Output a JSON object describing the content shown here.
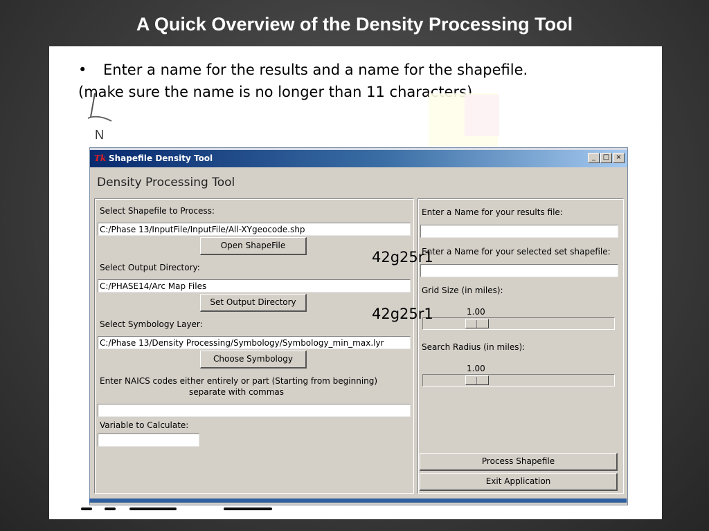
{
  "slide": {
    "title": "A Quick Overview of the Density Processing Tool",
    "bullet_marker": "•",
    "bullet_text": "Enter a name for the results and a name for the shapefile.",
    "note_text": "(make sure the name is no longer than 11 characters)",
    "north_label": "N"
  },
  "window": {
    "icon_text": "Tk",
    "title": "Shapefile Density Tool",
    "controls": {
      "minimize": "_",
      "maximize": "□",
      "close": "×"
    },
    "heading": "Density Processing Tool"
  },
  "left_panel": {
    "shapefile_label": "Select Shapefile to Process:",
    "shapefile_value": "C:/Phase 13/InputFile/InputFile/All-XYgeocode.shp",
    "open_button": "Open ShapeFile",
    "output_label": "Select Output Directory:",
    "output_value": "C:/PHASE14/Arc Map Files",
    "output_button": "Set Output Directory",
    "symbology_label": "Select Symbology Layer:",
    "symbology_value": "C:/Phase 13/Density Processing/Symbology/Symbology_min_max.lyr",
    "symbology_button": "Choose Symbology",
    "naics_label_line1": "Enter NAICS codes either entirely or part (Starting from beginning)",
    "naics_label_line2": "separate with commas",
    "naics_value": "",
    "variable_label": "Variable to Calculate:",
    "variable_value": ""
  },
  "right_panel": {
    "results_label": "Enter a Name for your results file:",
    "results_value": "",
    "selected_set_label": "Enter a Name for your selected set shapefile:",
    "selected_set_value": "",
    "grid_label": "Grid Size (in miles):",
    "grid_value": "1.00",
    "radius_label": "Search Radius (in miles):",
    "radius_value": "1.00",
    "process_button": "Process Shapefile",
    "exit_button": "Exit Application"
  },
  "overlay": {
    "label_one": "42g25r1",
    "label_two": "42g25r1"
  },
  "colors": {
    "titlebar_start": "#082a6e",
    "titlebar_end": "#a6caf0",
    "window_bg": "#d4d0c8",
    "slide_bg": "#3c3c3c"
  }
}
